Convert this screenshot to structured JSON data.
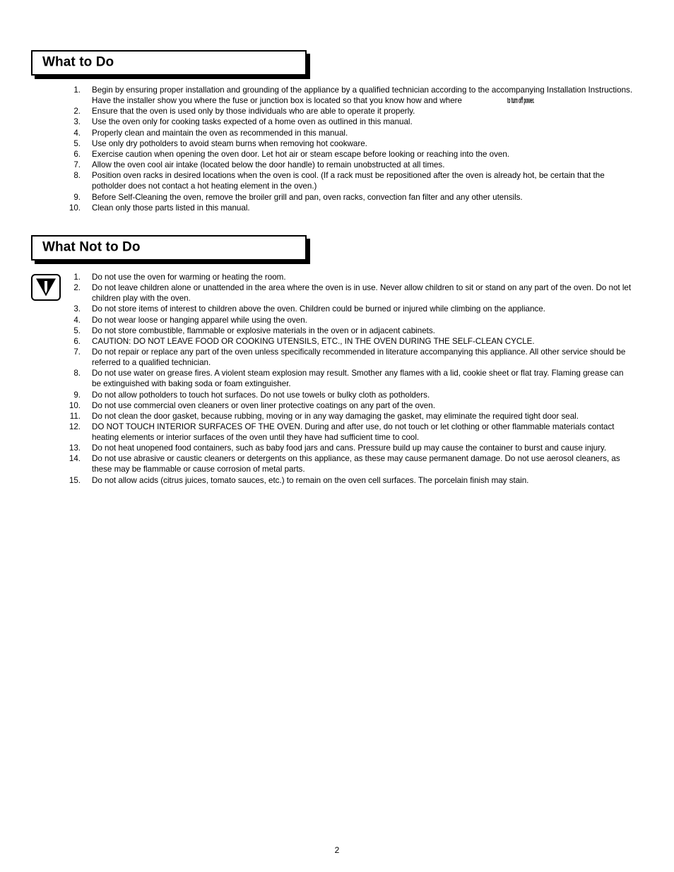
{
  "document": {
    "page_number": "2"
  },
  "sections": [
    {
      "id": "what-to-do",
      "heading": "What to Do",
      "has_warning_icon": false,
      "items": [
        {
          "number": "1.",
          "text": "Begin by ensuring proper installation and grounding of the appliance by a qualified technician according to the accompanying Installation Instructions. Have the installer show you where the fuse or junction box is located so that you know how and where",
          "condensed_tail": "to turn off power."
        },
        {
          "number": "2.",
          "text": "Ensure that the oven is used only by those individuals who are able to operate it properly."
        },
        {
          "number": "3.",
          "text": "Use the oven only for cooking tasks expected of a home oven as outlined in this manual."
        },
        {
          "number": "4.",
          "text": "Properly clean and maintain the oven as recommended in this manual."
        },
        {
          "number": "5.",
          "text": "Use only dry potholders to avoid steam burns when removing hot cookware."
        },
        {
          "number": "6.",
          "text": "Exercise caution when opening the oven door. Let hot air or steam escape before looking or reaching into the oven."
        },
        {
          "number": "7.",
          "text": "Allow the oven cool air intake (located below the door handle) to remain unobstructed at all times."
        },
        {
          "number": "8.",
          "text": "Position oven racks in desired locations when the oven is cool. (If a rack must be repositioned after the oven is already hot, be certain that the potholder does not contact a hot heating element in the oven.)"
        },
        {
          "number": "9.",
          "text": "Before Self-Cleaning the oven, remove the broiler grill and pan, oven racks, convection fan filter and any other utensils."
        },
        {
          "number": "10.",
          "text": "Clean only those parts listed in this manual."
        }
      ]
    },
    {
      "id": "what-not-to-do",
      "heading": "What Not to Do",
      "has_warning_icon": true,
      "warning_icon_name": "warning-triangle-icon",
      "items": [
        {
          "number": "1.",
          "text": "Do not use the oven for warming or heating the room."
        },
        {
          "number": "2.",
          "text": "Do not leave children alone or unattended in the area where the oven is in use. Never allow children to sit or stand on any part of the oven. Do not let children play with the oven."
        },
        {
          "number": "3.",
          "text": "Do not store items of interest to children above the oven. Children could be burned or injured while climbing on the appliance."
        },
        {
          "number": "4.",
          "text": "Do not wear loose or hanging apparel while using the oven."
        },
        {
          "number": "5.",
          "text": "Do not store combustible, flammable or explosive materials in the oven or in adjacent cabinets."
        },
        {
          "number": "6.",
          "text": "CAUTION: DO NOT LEAVE FOOD OR COOKING UTENSILS, ETC., IN THE OVEN DURING THE SELF-CLEAN CYCLE."
        },
        {
          "number": "7.",
          "text": "Do not repair or replace any part of the oven unless specifically recommended in literature accompanying this appliance. All other service should be referred to a qualified technician."
        },
        {
          "number": "8.",
          "text": "Do not use water on grease fires. A violent steam explosion may result. Smother any flames with a lid, cookie sheet or flat tray. Flaming grease can be extinguished with baking soda or foam extinguisher."
        },
        {
          "number": "9.",
          "text": "Do not allow potholders to touch hot surfaces. Do not use towels or bulky cloth as potholders."
        },
        {
          "number": "10.",
          "text": "Do not use commercial oven cleaners or oven liner protective coatings on any part of the oven."
        },
        {
          "number": "11.",
          "text": "Do not clean the door gasket, because rubbing, moving or in any way damaging the gasket, may eliminate the required tight door seal."
        },
        {
          "number": "12.",
          "text": "DO NOT TOUCH INTERIOR SURFACES OF THE OVEN. During and after use, do not touch or let clothing or other flammable materials contact heating elements or interior surfaces of the oven until they have had sufficient time to cool."
        },
        {
          "number": "13.",
          "text": "Do not heat unopened food containers, such as baby food jars and cans. Pressure build up may cause the container to burst and cause injury."
        },
        {
          "number": "14.",
          "text": "Do not use abrasive or caustic cleaners or detergents on this appliance, as these may cause permanent damage. Do not use aerosol cleaners, as these may be flammable or cause corrosion of metal parts."
        },
        {
          "number": "15.",
          "text": "Do not allow acids (citrus juices, tomato sauces, etc.) to remain on the oven cell surfaces. The porcelain finish may stain."
        }
      ]
    }
  ],
  "colors": {
    "text": "#000000",
    "background": "#ffffff",
    "box_border": "#000000",
    "box_shadow": "#000000"
  }
}
